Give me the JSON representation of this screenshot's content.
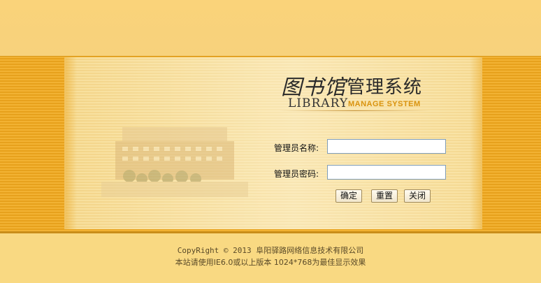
{
  "logo": {
    "title_calligraphy": "图书馆",
    "title_system": "管理系统",
    "title_en_main": "LIBRARY",
    "title_en_sub": "MANAGE SYSTEM"
  },
  "form": {
    "username_label": "管理员名称:",
    "username_value": "",
    "password_label": "管理员密码:",
    "password_value": "",
    "confirm_label": "确定",
    "reset_label": "重置",
    "close_label": "关闭"
  },
  "footer": {
    "copyright": "CopyRight © 2013 阜阳驿路网络信息技术有限公司",
    "notice": "本站请使用IE6.0或以上版本 1024*768为最佳显示效果"
  },
  "colors": {
    "background": "#f9d982",
    "stripe_dark": "#e7a11c",
    "accent_orange": "#d9930e"
  }
}
